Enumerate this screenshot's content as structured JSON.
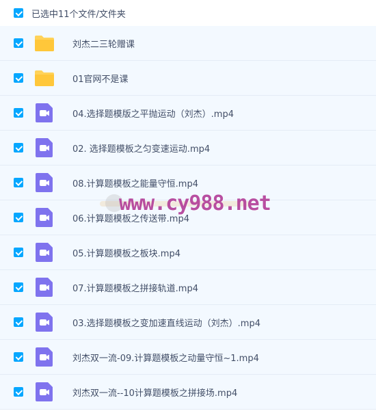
{
  "header": {
    "selection_label": "已选中11个文件/文件夹"
  },
  "files": [
    {
      "type": "folder",
      "name": "刘杰二三轮赠课"
    },
    {
      "type": "folder",
      "name": "01官网不是课"
    },
    {
      "type": "video",
      "name": "04.选择题模版之平抛运动（刘杰）.mp4"
    },
    {
      "type": "video",
      "name": "02. 选择题模板之匀变速运动.mp4"
    },
    {
      "type": "video",
      "name": "08.计算题模板之能量守恒.mp4"
    },
    {
      "type": "video",
      "name": "06.计算题模板之传送带.mp4"
    },
    {
      "type": "video",
      "name": "05.计算题模板之板块.mp4"
    },
    {
      "type": "video",
      "name": "07.计算题模板之拼接轨道.mp4"
    },
    {
      "type": "video",
      "name": "03.选择题模板之变加速直线运动（刘杰）.mp4"
    },
    {
      "type": "video",
      "name": "刘杰双一流-09.计算题模板之动量守恒~1.mp4"
    },
    {
      "type": "video",
      "name": "刘杰双一流--10计算题模板之拼接场.mp4"
    }
  ],
  "watermark": {
    "text": "www.cy988.net"
  },
  "colors": {
    "accent": "#06a7ff",
    "folder": "#ffd259",
    "video": "#7f73ee",
    "row_bg": "#f3f9ff"
  }
}
